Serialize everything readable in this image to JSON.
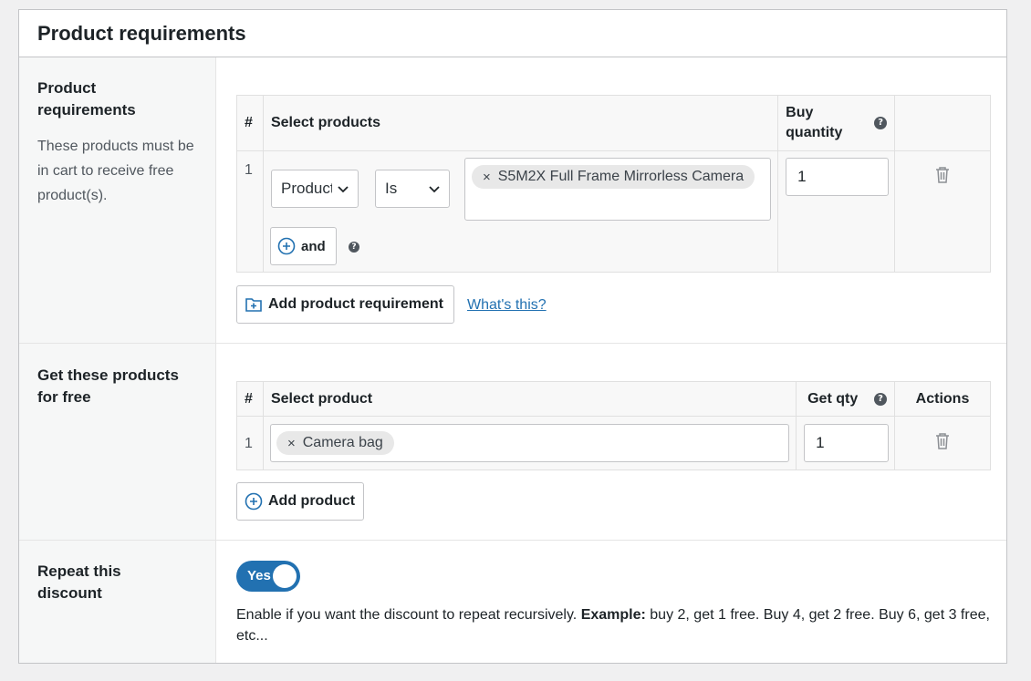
{
  "panel": {
    "title": "Product requirements"
  },
  "requirements": {
    "label": "Product requirements",
    "description": "These products must be in cart to receive free product(s).",
    "columns": {
      "index": "#",
      "select": "Select products",
      "qty": "Buy quantity"
    },
    "rows": [
      {
        "index": "1",
        "type_value": "Product",
        "operator_value": "Is",
        "selected_product": "S5M2X Full Frame Mirrorless Camera",
        "quantity": "1"
      }
    ],
    "and_button": "and",
    "add_button": "Add product requirement",
    "help_link": "What's this?"
  },
  "free_products": {
    "label": "Get these products for free",
    "columns": {
      "index": "#",
      "select": "Select product",
      "qty": "Get qty",
      "actions": "Actions"
    },
    "rows": [
      {
        "index": "1",
        "selected_product": "Camera bag",
        "quantity": "1"
      }
    ],
    "add_button": "Add product"
  },
  "repeat": {
    "label": "Repeat this discount",
    "toggle_label": "Yes",
    "toggle_on": true,
    "description_prefix": "Enable if you want the discount to repeat recursively. ",
    "description_bold": "Example:",
    "description_suffix": " buy 2, get 1 free. Buy 4, get 2 free. Buy 6, get 3 free, etc..."
  },
  "colors": {
    "accent": "#2271b1",
    "border": "#c3c4c7",
    "label_bg": "#f6f7f7"
  },
  "icons": {
    "help": "?",
    "remove": "×"
  }
}
